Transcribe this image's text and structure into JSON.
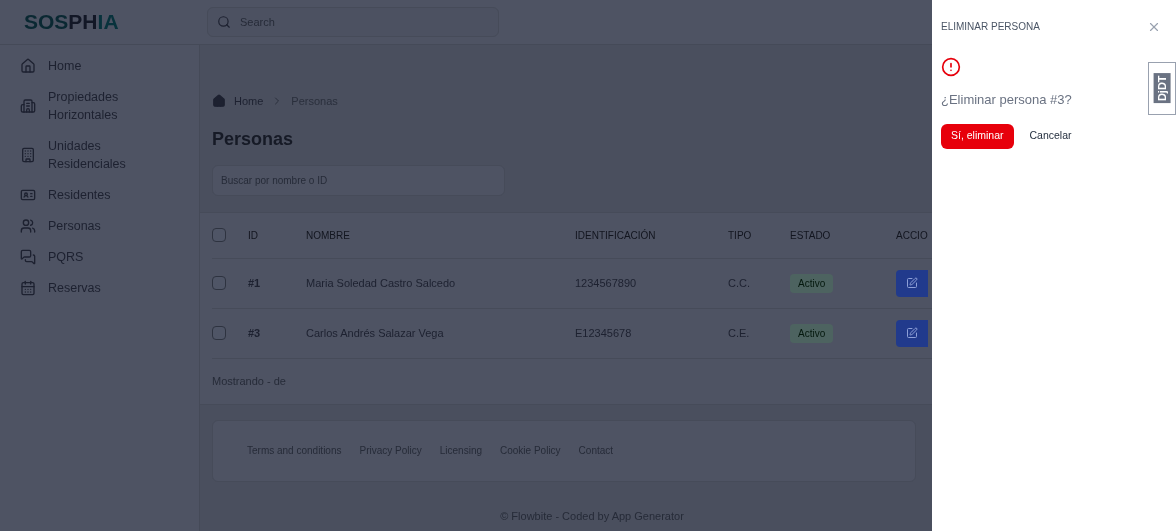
{
  "logo": [
    {
      "text": "SOS",
      "color": "#0a2832"
    },
    {
      "text": "PH",
      "color": "#121726"
    },
    {
      "text": "IA",
      "color": "#08323c"
    }
  ],
  "search": {
    "placeholder": "Search"
  },
  "sidebar": {
    "items": [
      {
        "label": "Home"
      },
      {
        "label": "Propiedades Horizontales"
      },
      {
        "label": "Unidades Residenciales"
      },
      {
        "label": "Residentes"
      },
      {
        "label": "Personas"
      },
      {
        "label": "PQRS"
      },
      {
        "label": "Reservas"
      }
    ]
  },
  "breadcrumb": [
    "Home",
    "Personas"
  ],
  "page_title": "Personas",
  "filter": {
    "placeholder": "Buscar por nombre o ID"
  },
  "table": {
    "header_checked": false,
    "columns": [
      "ID",
      "NOMBRE",
      "IDENTIFICACIÓN",
      "TIPO",
      "ESTADO",
      "ACCIO"
    ],
    "rows": [
      {
        "checked": false,
        "id": "#1",
        "name": "Maria Soledad Castro Salcedo",
        "identification": "1234567890",
        "type": "C.C.",
        "status": "Activo"
      },
      {
        "checked": false,
        "id": "#3",
        "name": "Carlos Andrés Salazar Vega",
        "identification": "E12345678",
        "type": "C.E.",
        "status": "Activo"
      }
    ]
  },
  "pagination_text": "Mostrando - de",
  "footer": {
    "links": [
      "Terms and conditions",
      "Privacy Policy",
      "Licensing",
      "Cookie Policy",
      "Contact"
    ],
    "credit": "© Flowbite - Coded by App Generator"
  },
  "drawer": {
    "title": "ELIMINAR PERSONA",
    "message": "¿Eliminar persona #3?",
    "buttons": [
      {
        "label": "Sí, eliminar",
        "kind": "danger"
      },
      {
        "label": "Cancelar",
        "kind": "plain"
      }
    ]
  },
  "debug_toolbar": {
    "label": "DjDT"
  }
}
